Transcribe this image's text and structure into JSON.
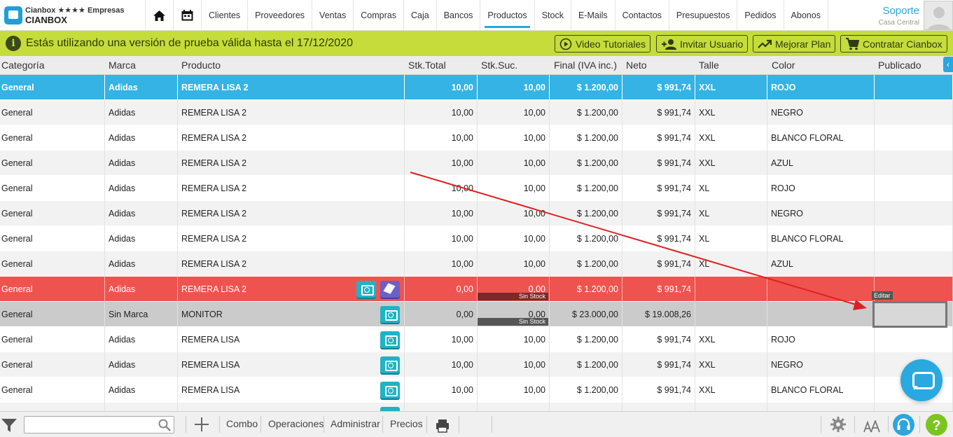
{
  "brand": {
    "subtitle": "Cianbox ★★★★ Empresas",
    "name": "CIANBOX"
  },
  "nav": {
    "items": [
      "Clientes",
      "Proveedores",
      "Ventas",
      "Compras",
      "Caja",
      "Bancos",
      "Productos",
      "Stock",
      "E-Mails",
      "Contactos",
      "Presupuestos",
      "Pedidos",
      "Abonos"
    ],
    "active": "Productos",
    "user_name": "Soporte",
    "user_branch": "Casa Central"
  },
  "banner": {
    "message": "Estás utilizando una versión de prueba válida hasta el 17/12/2020",
    "buttons": [
      "Video Tutoriales",
      "Invitar Usuario",
      "Mejorar Plan",
      "Contratar Cianbox"
    ]
  },
  "table": {
    "columns": [
      "Categoría",
      "Marca",
      "Producto",
      "Stk.Total",
      "Stk.Suc.",
      "Final (IVA inc.)",
      "Neto",
      "Talle",
      "Color",
      "Publicado"
    ],
    "rows": [
      {
        "categoria": "General",
        "marca": "Adidas",
        "producto": "REMERA LISA 2",
        "stk_total": "10,00",
        "stk_suc": "10,00",
        "final": "$ 1.200,00",
        "neto": "$ 991,74",
        "talle": "XXL",
        "color": "ROJO",
        "style": "sel"
      },
      {
        "categoria": "General",
        "marca": "Adidas",
        "producto": "REMERA LISA 2",
        "stk_total": "10,00",
        "stk_suc": "10,00",
        "final": "$ 1.200,00",
        "neto": "$ 991,74",
        "talle": "XXL",
        "color": "NEGRO",
        "style": "zebra"
      },
      {
        "categoria": "General",
        "marca": "Adidas",
        "producto": "REMERA LISA 2",
        "stk_total": "10,00",
        "stk_suc": "10,00",
        "final": "$ 1.200,00",
        "neto": "$ 991,74",
        "talle": "XXL",
        "color": "BLANCO FLORAL",
        "style": "plain"
      },
      {
        "categoria": "General",
        "marca": "Adidas",
        "producto": "REMERA LISA 2",
        "stk_total": "10,00",
        "stk_suc": "10,00",
        "final": "$ 1.200,00",
        "neto": "$ 991,74",
        "talle": "XXL",
        "color": "AZUL",
        "style": "zebra"
      },
      {
        "categoria": "General",
        "marca": "Adidas",
        "producto": "REMERA LISA 2",
        "stk_total": "10,00",
        "stk_suc": "10,00",
        "final": "$ 1.200,00",
        "neto": "$ 991,74",
        "talle": "XL",
        "color": "ROJO",
        "style": "plain"
      },
      {
        "categoria": "General",
        "marca": "Adidas",
        "producto": "REMERA LISA 2",
        "stk_total": "10,00",
        "stk_suc": "10,00",
        "final": "$ 1.200,00",
        "neto": "$ 991,74",
        "talle": "XL",
        "color": "NEGRO",
        "style": "zebra"
      },
      {
        "categoria": "General",
        "marca": "Adidas",
        "producto": "REMERA LISA 2",
        "stk_total": "10,00",
        "stk_suc": "10,00",
        "final": "$ 1.200,00",
        "neto": "$ 991,74",
        "talle": "XL",
        "color": "BLANCO FLORAL",
        "style": "plain"
      },
      {
        "categoria": "General",
        "marca": "Adidas",
        "producto": "REMERA LISA 2",
        "stk_total": "10,00",
        "stk_suc": "10,00",
        "final": "$ 1.200,00",
        "neto": "$ 991,74",
        "talle": "XL",
        "color": "AZUL",
        "style": "zebra"
      },
      {
        "categoria": "General",
        "marca": "Adidas",
        "producto": "REMERA LISA 2",
        "stk_total": "0,00",
        "stk_suc": "0,00",
        "final": "$ 1.200,00",
        "neto": "$ 991,74",
        "talle": "",
        "color": "",
        "style": "red",
        "badge": "Sin Stock",
        "badge_color": "#7a2a2a",
        "icons": [
          "camera-icon",
          "cube-icon"
        ]
      },
      {
        "categoria": "General",
        "marca": "Sin Marca",
        "producto": "MONITOR",
        "stk_total": "0,00",
        "stk_suc": "0,00",
        "final": "$ 23.000,00",
        "neto": "$ 19.008,26",
        "talle": "",
        "color": "",
        "style": "gray",
        "badge": "Sin Stock",
        "badge_color": "#555555",
        "icons": [
          "camera-icon"
        ]
      },
      {
        "categoria": "General",
        "marca": "Adidas",
        "producto": "REMERA LISA",
        "stk_total": "10,00",
        "stk_suc": "10,00",
        "final": "$ 1.200,00",
        "neto": "$ 991,74",
        "talle": "XXL",
        "color": "ROJO",
        "style": "plain",
        "icons": [
          "camera-icon"
        ]
      },
      {
        "categoria": "General",
        "marca": "Adidas",
        "producto": "REMERA LISA",
        "stk_total": "10,00",
        "stk_suc": "10,00",
        "final": "$ 1.200,00",
        "neto": "$ 991,74",
        "talle": "XXL",
        "color": "NEGRO",
        "style": "zebra",
        "icons": [
          "camera-icon"
        ]
      },
      {
        "categoria": "General",
        "marca": "Adidas",
        "producto": "REMERA LISA",
        "stk_total": "10,00",
        "stk_suc": "10,00",
        "final": "$ 1.200,00",
        "neto": "$ 991,74",
        "talle": "XXL",
        "color": "BLANCO FLORAL",
        "style": "plain",
        "icons": [
          "camera-icon"
        ]
      },
      {
        "categoria": "",
        "marca": "",
        "producto": "",
        "stk_total": "",
        "stk_suc": "",
        "final": "",
        "neto": "",
        "talle": "",
        "color": "",
        "style": "zebra",
        "icons": [
          "camera-icon"
        ]
      }
    ]
  },
  "overlay": {
    "edit_tooltip": "Editar"
  },
  "toolbar": {
    "search_placeholder": "",
    "buttons": [
      "Combo",
      "Operaciones",
      "Administrar",
      "Precios"
    ]
  },
  "colors": {
    "accent": "#2ba6de",
    "banner": "#c6dc3a",
    "selected_row": "#34b3e4",
    "no_stock_row": "#ef5350",
    "arrow": "#e02020",
    "help": "#7cc520"
  }
}
